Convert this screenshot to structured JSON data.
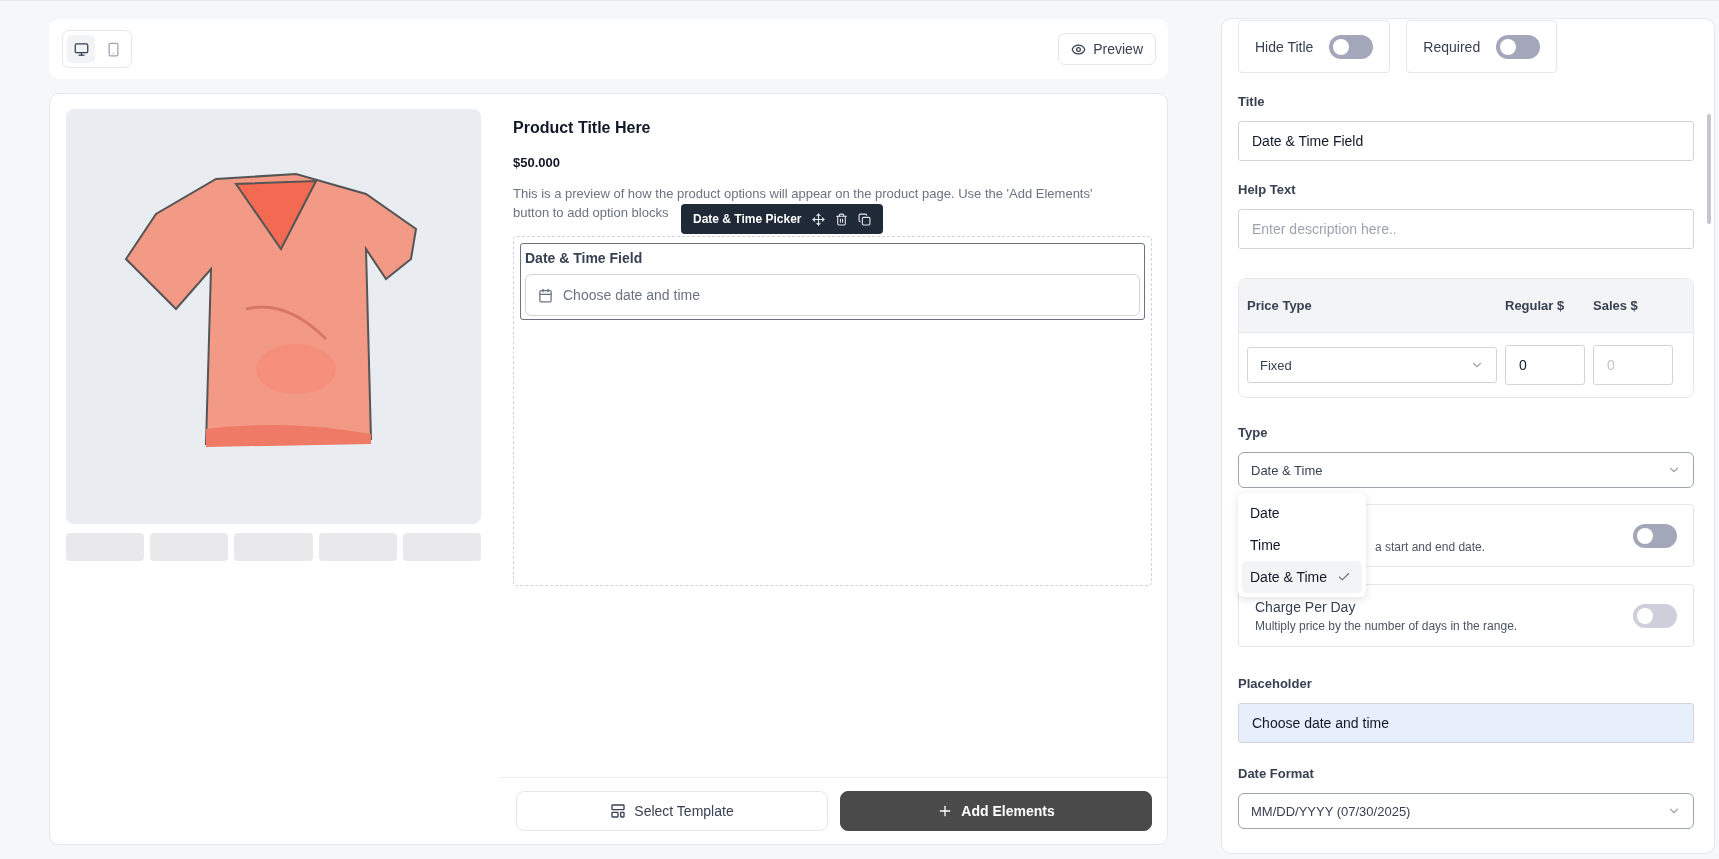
{
  "toolbar": {
    "devices": [
      {
        "kind": "desktop",
        "selected": true
      },
      {
        "kind": "mobile",
        "selected": false
      }
    ],
    "preview_button": "Preview"
  },
  "product": {
    "image": {
      "kind": "picture"
    },
    "title": "Product Title Here",
    "price": "$50.000",
    "description_lines": [
      "This is a preview of how the product options will appear on the product page. Use the 'Add Elements'",
      "button to add option blocks"
    ]
  },
  "element_toolbar": {
    "label": "Date & Time Picker"
  },
  "field": {
    "title": "Date & Time Field",
    "placeholder": "Choose date and time"
  },
  "footer_buttons": [
    {
      "kind": "outline",
      "label": "Select Template"
    },
    {
      "kind": "solid",
      "label": "Add Elements"
    }
  ],
  "settings": {
    "toggles": [
      {
        "label": "Hide Title",
        "on": false
      },
      {
        "label": "Required",
        "on": false
      }
    ],
    "title": {
      "label": "Title",
      "value": "Date & Time Field"
    },
    "help_text": {
      "label": "Help Text",
      "placeholder": "Enter description here.."
    },
    "price_table": {
      "columns": [
        "Price Type",
        "Regular $",
        "Sales $"
      ],
      "price_type": "Fixed",
      "regular": "0",
      "sales_placeholder": "0"
    },
    "type": {
      "label": "Type",
      "value": "Date & Time",
      "options": [
        {
          "label": "Date",
          "selected": false
        },
        {
          "label": "Time",
          "selected": false
        },
        {
          "label": "Date & Time",
          "selected": true
        }
      ]
    },
    "options": [
      {
        "description": "a start and end date.",
        "on": false,
        "disabled": false
      },
      {
        "title": "Charge Per Day",
        "description": "Multiply price by the number of days in the range.",
        "on": false,
        "disabled": true
      }
    ],
    "placeholder": {
      "label": "Placeholder",
      "value": "Choose date and time"
    },
    "date_format": {
      "label": "Date Format",
      "value": "MM/DD/YYYY (07/30/2025)"
    }
  }
}
